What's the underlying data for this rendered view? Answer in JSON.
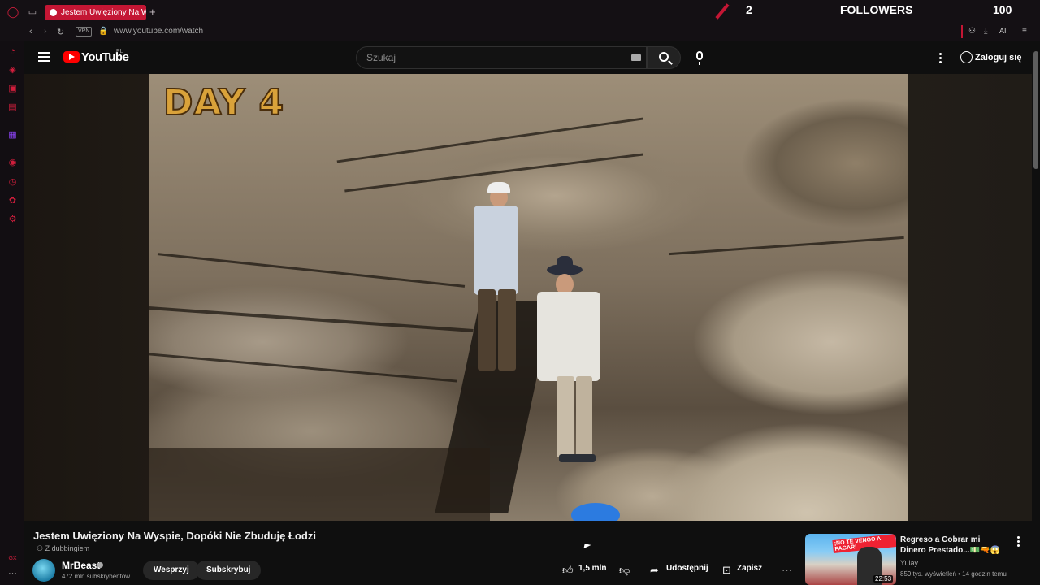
{
  "browser": {
    "tab_title": "Jestem Uwięziony Na W",
    "url": "www.youtube.com/watch",
    "vpn_label": "VPN",
    "ai_label": "AI"
  },
  "overlay": {
    "count_left": "2",
    "followers_label": "FOLLOWERS",
    "count_right": "100"
  },
  "masthead": {
    "logo_text": "YouTube",
    "region": "PL",
    "search_placeholder": "Szukaj",
    "signin_label": "Zaloguj się"
  },
  "player": {
    "badge_text": "DAY 4"
  },
  "video": {
    "title": "Jestem Uwięziony Na Wyspie, Dopóki Nie Zbuduję Łodzi",
    "dubbing": "Z dubbingiem",
    "channel_name": "MrBeast",
    "subscribers": "472 mln subskrybentów",
    "support_label": "Wesprzyj",
    "subscribe_label": "Subskrybuj",
    "likes": "1,5 mln",
    "share_label": "Udostępnij",
    "save_label": "Zapisz"
  },
  "recommendation": {
    "title": "Regreso a Cobrar mi Dinero Prestado...💵🔫😱",
    "channel": "Yulay",
    "meta": "859 tys. wyświetleń • 14 godzin temu",
    "duration": "22:53",
    "thumb_text": "¡NO TE VENGO A PAGAR!"
  },
  "colors": {
    "gx_accent": "#c41634",
    "yt_red": "#ff0000",
    "background": "#0f0f0f"
  },
  "icons": [
    "opera-gx-icon",
    "back-icon",
    "forward-icon",
    "reload-icon",
    "lock-icon",
    "search-icon",
    "keyboard-icon",
    "mic-icon",
    "menu-icon",
    "like-icon",
    "dislike-icon",
    "share-icon",
    "save-icon",
    "more-icon"
  ]
}
